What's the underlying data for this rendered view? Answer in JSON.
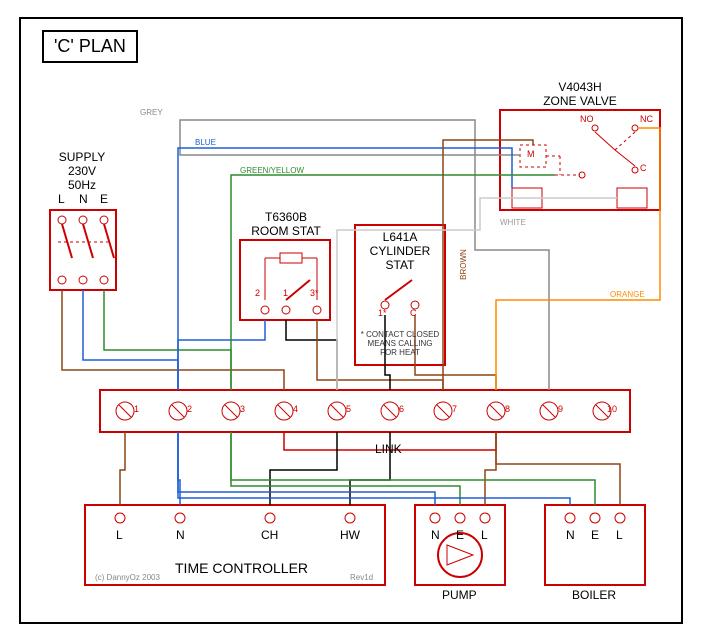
{
  "plan_title": "'C' PLAN",
  "supply": {
    "title1": "SUPPLY",
    "title2": "230V",
    "title3": "50Hz",
    "L": "L",
    "N": "N",
    "E": "E"
  },
  "room_stat": {
    "line1": "T6360B",
    "line2": "ROOM STAT",
    "t1": "1",
    "t2": "2",
    "t3": "3*"
  },
  "cyl_stat": {
    "line1": "L641A",
    "line2": "CYLINDER",
    "line3": "STAT",
    "t1": "1*",
    "t2": "C",
    "note1": "* CONTACT CLOSED",
    "note2": "MEANS CALLING",
    "note3": "FOR HEAT"
  },
  "zone_valve": {
    "line1": "V4043H",
    "line2": "ZONE VALVE",
    "M": "M",
    "NO": "NO",
    "NC": "NC",
    "C": "C"
  },
  "strip": {
    "t1": "1",
    "t2": "2",
    "t3": "3",
    "t4": "4",
    "t5": "5",
    "t6": "6",
    "t7": "7",
    "t8": "8",
    "t9": "9",
    "t10": "10",
    "link": "LINK"
  },
  "timer": {
    "title": "TIME CONTROLLER",
    "L": "L",
    "N": "N",
    "CH": "CH",
    "HW": "HW"
  },
  "pump": {
    "title": "PUMP",
    "N": "N",
    "E": "E",
    "L": "L"
  },
  "boiler": {
    "title": "BOILER",
    "N": "N",
    "E": "E",
    "L": "L"
  },
  "wires": {
    "grey": "GREY",
    "blue": "BLUE",
    "gy": "GREEN/YELLOW",
    "brown": "BROWN",
    "white": "WHITE",
    "orange": "ORANGE"
  },
  "footer": {
    "copy": "(c) DannyOz 2003",
    "rev": "Rev1d"
  }
}
